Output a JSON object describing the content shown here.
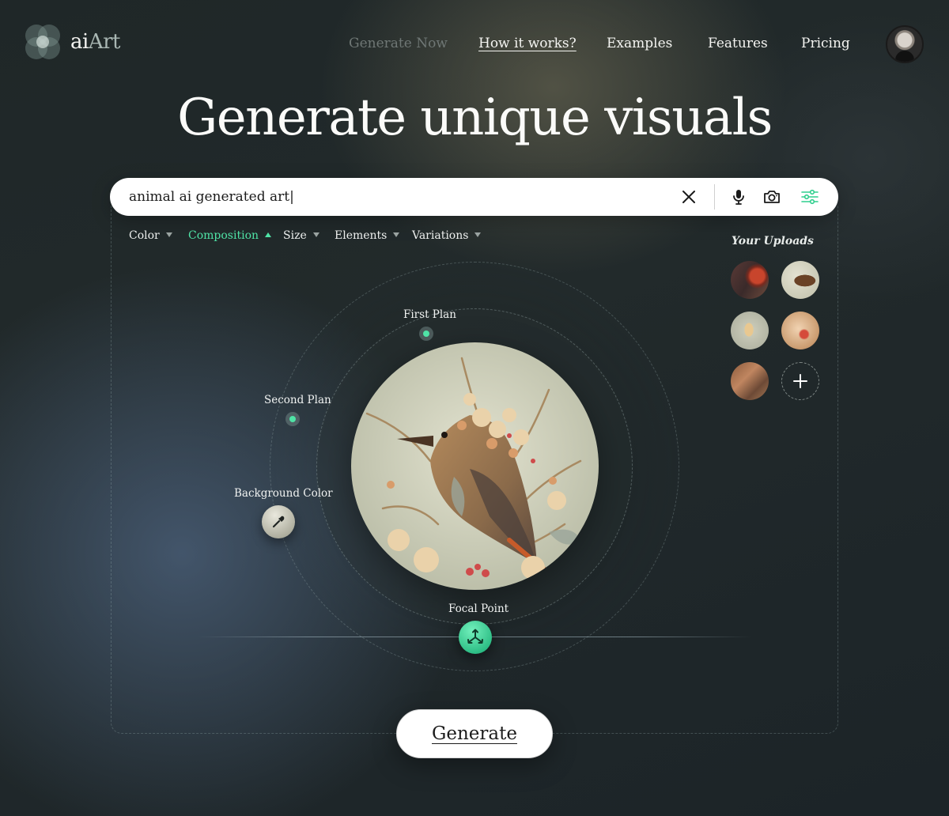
{
  "brand": {
    "name_part1": "ai",
    "name_part2": "Art"
  },
  "nav": {
    "items": [
      {
        "label": "Generate Now"
      },
      {
        "label": "How it works?"
      },
      {
        "label": "Examples"
      },
      {
        "label": "Features"
      },
      {
        "label": "Pricing"
      }
    ]
  },
  "hero": {
    "title": "Generate unique visuals"
  },
  "search": {
    "value": "animal ai generated art|"
  },
  "filters": [
    {
      "label": "Color"
    },
    {
      "label": "Composition"
    },
    {
      "label": "Size"
    },
    {
      "label": "Elements"
    },
    {
      "label": "Variations"
    }
  ],
  "uploads": {
    "title": "Your Uploads"
  },
  "composition": {
    "first_plan": "First Plan",
    "second_plan": "Second Plan",
    "background_color": "Background Color",
    "focal_point": "Focal Point"
  },
  "generate": {
    "label": "Generate"
  },
  "colors": {
    "accent": "#4fe3a6",
    "background": "#222a2b",
    "search_bg": "#ffffff"
  }
}
